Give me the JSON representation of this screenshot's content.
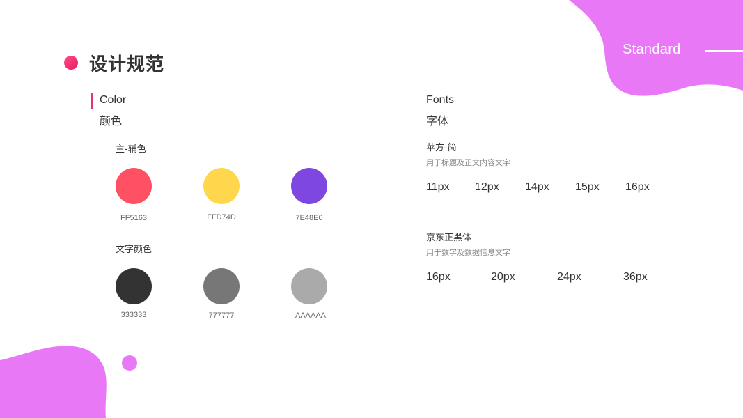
{
  "corner": {
    "label": "Standard",
    "blob_color": "#e878f5"
  },
  "header": {
    "title": "设计规范",
    "accent": "#e9336d"
  },
  "color_section": {
    "title_en": "Color",
    "title_cn": "颜色",
    "groups": [
      {
        "label": "主-辅色",
        "swatches": [
          {
            "hex": "#FF5163",
            "label": "FF5163"
          },
          {
            "hex": "#FFD74D",
            "label": "FFD74D"
          },
          {
            "hex": "#7E48E0",
            "label": "7E48E0"
          }
        ]
      },
      {
        "label": "文字颜色",
        "swatches": [
          {
            "hex": "#333333",
            "label": "333333"
          },
          {
            "hex": "#777777",
            "label": "777777"
          },
          {
            "hex": "#AAAAAA",
            "label": "AAAAAA"
          }
        ]
      }
    ]
  },
  "fonts_section": {
    "title_en": "Fonts",
    "title_cn": "字体",
    "families": [
      {
        "name": "苹方-简",
        "desc": "用于标题及正文内容文字",
        "sizes": [
          "11px",
          "12px",
          "14px",
          "15px",
          "16px"
        ]
      },
      {
        "name": "京东正黑体",
        "desc": "用于数字及数据信息文字",
        "sizes": [
          "16px",
          "20px",
          "24px",
          "36px"
        ]
      }
    ]
  }
}
